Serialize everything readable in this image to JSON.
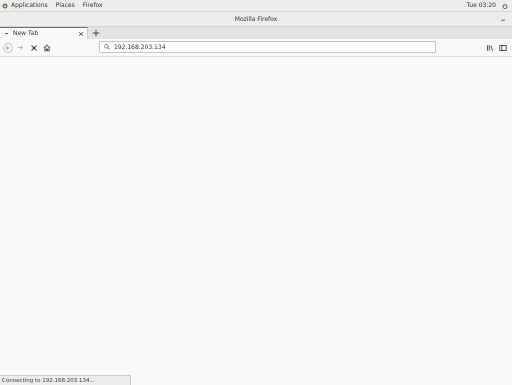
{
  "topbar": {
    "menu": [
      "Applications",
      "Places",
      "Firefox"
    ],
    "clock": "Tue 03:20"
  },
  "window": {
    "title": "Mozilla Firefox"
  },
  "tabs": [
    {
      "label": "New Tab",
      "active": true
    }
  ],
  "urlbar": {
    "value": "192.168.203.134",
    "placeholder": ""
  },
  "status": {
    "text": "Connecting to 192.168.203.134..."
  },
  "colors": {
    "accent": "#0a84ff",
    "chrome_bg": "#ededed",
    "page_bg": "#f9f9f9"
  },
  "icons": [
    "applications-icon",
    "power-icon",
    "window-menu-icon",
    "tab-favicon",
    "close-icon",
    "plus-icon",
    "back-arrow-icon",
    "forward-arrow-icon",
    "stop-icon",
    "home-icon",
    "search-icon",
    "library-icon",
    "sidebar-icon"
  ]
}
